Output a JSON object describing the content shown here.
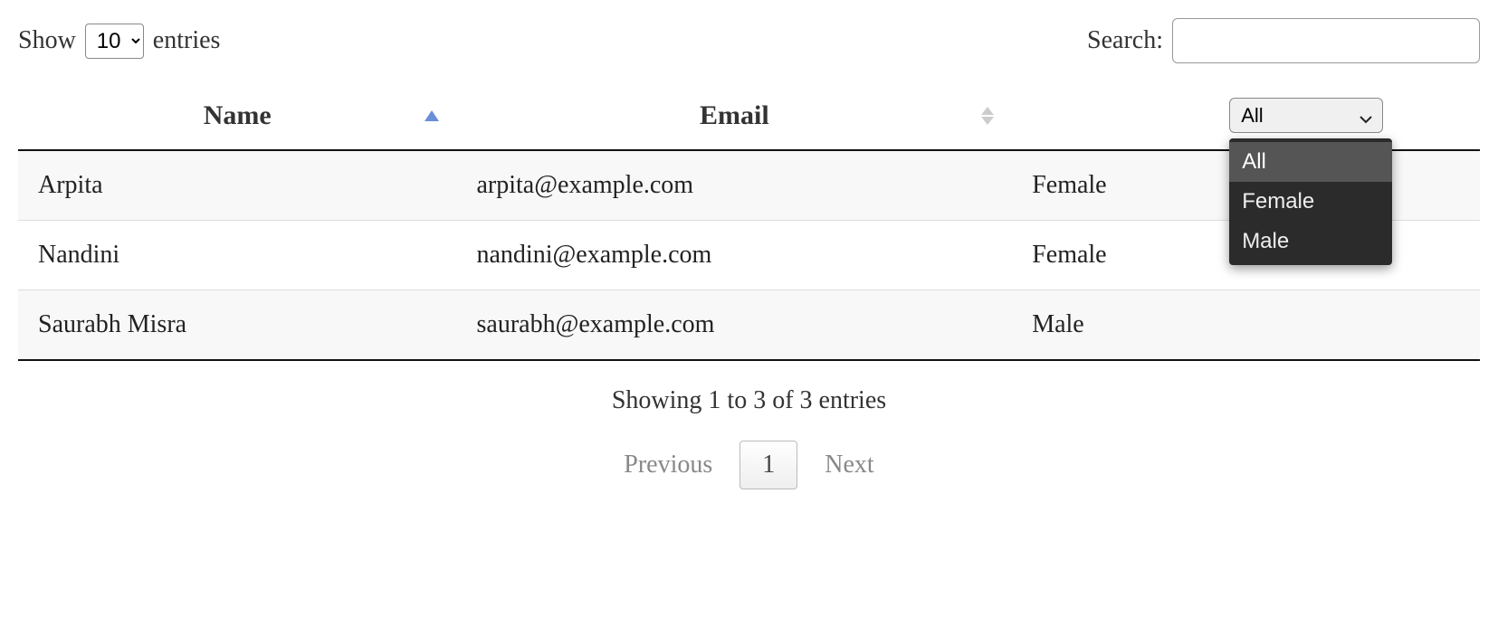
{
  "length": {
    "prefix": "Show",
    "suffix": "entries",
    "selected": "10"
  },
  "search": {
    "label": "Search:",
    "value": ""
  },
  "columns": {
    "name": "Name",
    "email": "Email"
  },
  "gender_filter": {
    "selected": "All",
    "options": [
      "All",
      "Female",
      "Male"
    ]
  },
  "rows": [
    {
      "name": "Arpita",
      "email": "arpita@example.com",
      "gender": "Female"
    },
    {
      "name": "Nandini",
      "email": "nandini@example.com",
      "gender": "Female"
    },
    {
      "name": "Saurabh Misra",
      "email": "saurabh@example.com",
      "gender": "Male"
    }
  ],
  "info": "Showing 1 to 3 of 3 entries",
  "pagination": {
    "previous": "Previous",
    "next": "Next",
    "current": "1"
  }
}
